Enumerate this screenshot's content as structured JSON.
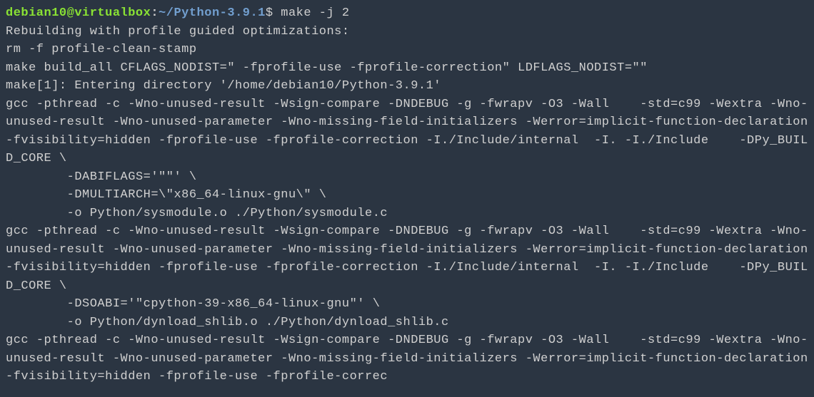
{
  "prompt": {
    "user_host": "debian10@virtualbox",
    "colon": ":",
    "tilde": "~",
    "path": "/Python-3.9.1",
    "dollar": "$ "
  },
  "command": "make -j 2",
  "output_lines": [
    "Rebuilding with profile guided optimizations:",
    "rm -f profile-clean-stamp",
    "make build_all CFLAGS_NODIST=\" -fprofile-use -fprofile-correction\" LDFLAGS_NODIST=\"\"",
    "make[1]: Entering directory '/home/debian10/Python-3.9.1'",
    "gcc -pthread -c -Wno-unused-result -Wsign-compare -DNDEBUG -g -fwrapv -O3 -Wall    -std=c99 -Wextra -Wno-unused-result -Wno-unused-parameter -Wno-missing-field-initializers -Werror=implicit-function-declaration -fvisibility=hidden -fprofile-use -fprofile-correction -I./Include/internal  -I. -I./Include    -DPy_BUILD_CORE \\",
    "        -DABIFLAGS='\"\"' \\",
    "        -DMULTIARCH=\\\"x86_64-linux-gnu\\\" \\",
    "        -o Python/sysmodule.o ./Python/sysmodule.c",
    "gcc -pthread -c -Wno-unused-result -Wsign-compare -DNDEBUG -g -fwrapv -O3 -Wall    -std=c99 -Wextra -Wno-unused-result -Wno-unused-parameter -Wno-missing-field-initializers -Werror=implicit-function-declaration -fvisibility=hidden -fprofile-use -fprofile-correction -I./Include/internal  -I. -I./Include    -DPy_BUILD_CORE \\",
    "        -DSOABI='\"cpython-39-x86_64-linux-gnu\"' \\",
    "        -o Python/dynload_shlib.o ./Python/dynload_shlib.c",
    "gcc -pthread -c -Wno-unused-result -Wsign-compare -DNDEBUG -g -fwrapv -O3 -Wall    -std=c99 -Wextra -Wno-unused-result -Wno-unused-parameter -Wno-missing-field-initializers -Werror=implicit-function-declaration -fvisibility=hidden -fprofile-use -fprofile-correc"
  ]
}
